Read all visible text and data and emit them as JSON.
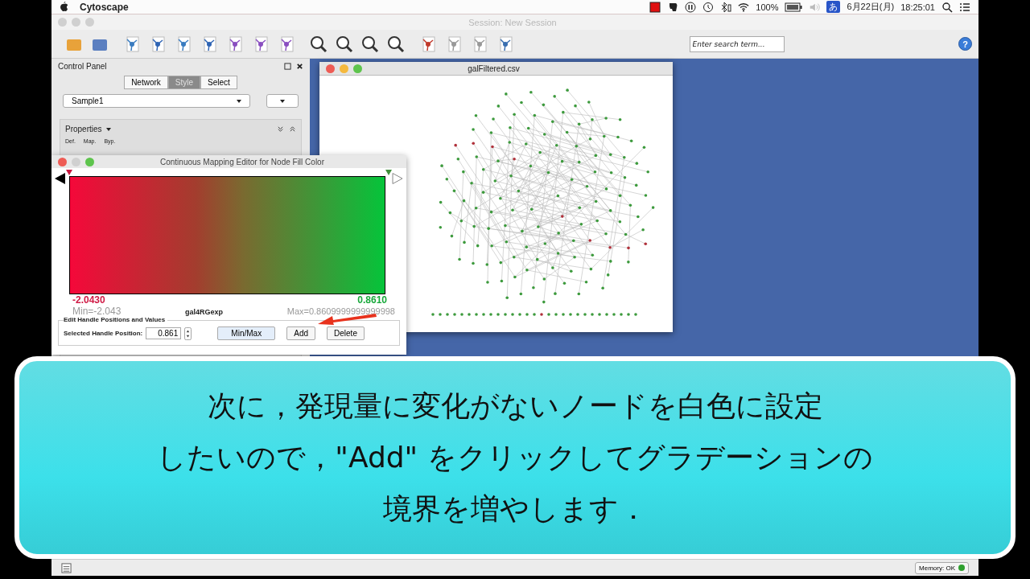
{
  "menubar": {
    "app_name": "Cytoscape",
    "battery": "100%",
    "input_method": "あ",
    "date": "6月22日(月)",
    "time": "18:25:01"
  },
  "window": {
    "title": "Session: New Session"
  },
  "toolbar": {
    "search": {
      "placeholder": "Enter search term..."
    },
    "help": "?"
  },
  "control_panel": {
    "title": "Control Panel",
    "tabs": [
      {
        "label": "Network",
        "selected": false
      },
      {
        "label": "Style",
        "selected": true
      },
      {
        "label": "Select",
        "selected": false
      }
    ],
    "style_dropdown": "Sample1",
    "properties": "Properties",
    "columns": [
      "Def.",
      "Map.",
      "Byp."
    ]
  },
  "network_window": {
    "title": "galFiltered.csv"
  },
  "mapping_editor": {
    "title": "Continuous Mapping Editor for Node Fill Color",
    "handles": [
      {
        "color": "#c8163f"
      },
      {
        "color": "#3f8f3a"
      }
    ],
    "min_value": "-2.0430",
    "max_value": "0.8610",
    "min_label": "Min=-2.043",
    "attribute": "gal4RGexp",
    "max_label": "Max=0.8609999999999998",
    "group_label": "Edit Handle Positions and Values",
    "position_label": "Selected Handle Position:",
    "position_value": "0.861",
    "buttons": [
      "Min/Max",
      "Add",
      "Delete"
    ]
  },
  "caption": {
    "lines": [
      "次に，発現量に変化がないノードを白色に設定",
      "したいので，\"Add\" をクリックしてグラデーションの",
      "境界を増やします．"
    ]
  },
  "status_bar": {
    "memory": "Memory: OK"
  }
}
